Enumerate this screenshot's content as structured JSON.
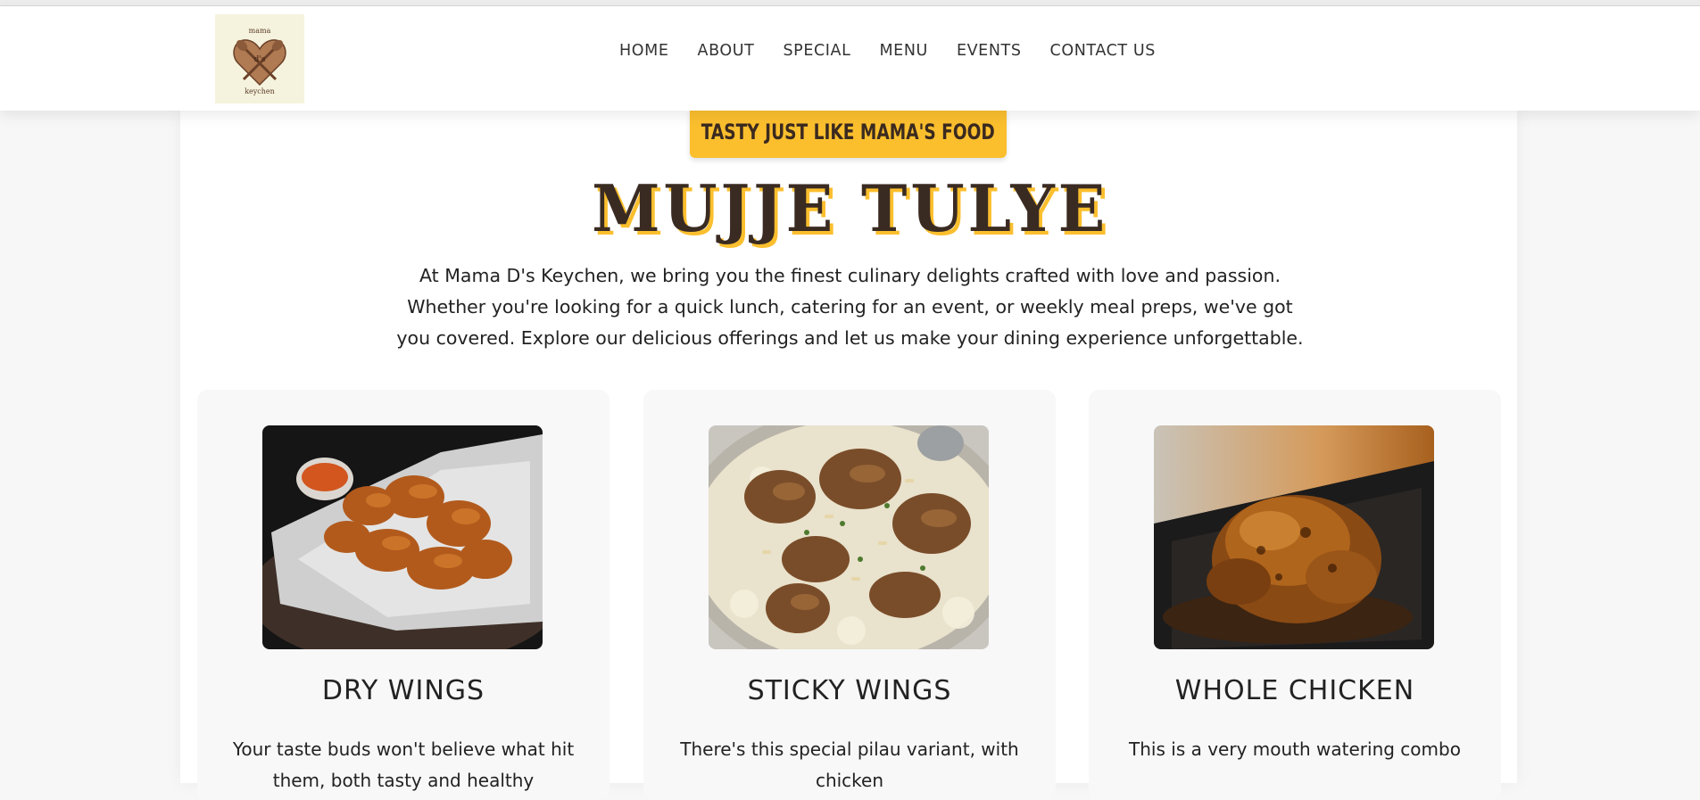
{
  "brand": {
    "logo_alt": "Mama D's Keychen",
    "logo_text_top": "mama",
    "logo_text_mid": "d's",
    "logo_text_bottom": "keychen"
  },
  "nav": {
    "items": [
      "HOME",
      "ABOUT",
      "SPECIAL",
      "MENU",
      "EVENTS",
      "CONTACT US"
    ]
  },
  "hero": {
    "tagline": "TASTY JUST LIKE MAMA'S FOOD",
    "title": "MUJJE TULYE",
    "intro": "At Mama D's Keychen, we bring you the finest culinary delights crafted with love and passion. Whether you're looking for a quick lunch, catering for an event, or weekly meal preps, we've got you covered. Explore our delicious offerings and let us make your dining experience unforgettable."
  },
  "cards": [
    {
      "title": "DRY WINGS",
      "text": "Your taste buds won't believe what hit them, both tasty and healthy"
    },
    {
      "title": "STICKY WINGS",
      "text": "There's this special pilau variant, with chicken"
    },
    {
      "title": "WHOLE CHICKEN",
      "text": "This is a very mouth watering combo"
    }
  ],
  "colors": {
    "accent": "#fbbf2e",
    "title": "#3a2b22",
    "background": "#f7f7f7"
  },
  "icons": {
    "logo": "heart-spoons-logo-icon"
  }
}
